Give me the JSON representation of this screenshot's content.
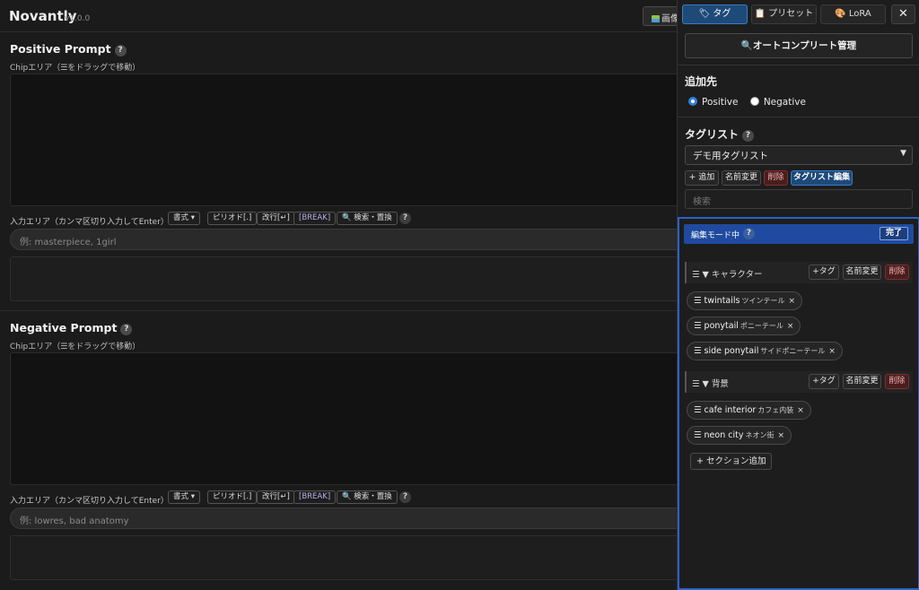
{
  "header": {
    "app_name": "Novantly",
    "version": "v1.0.0",
    "image_button": "画像"
  },
  "positive": {
    "title": "Positive Prompt",
    "help": "?",
    "chip_hint": "Chipエリア（☰をドラッグで移動）",
    "input_label": "入力エリア（カンマ区切り入力してEnter）",
    "toolbar": [
      "書式 ▾",
      "ピリオド[.]",
      "改行[↵]",
      "[BREAK]",
      "🔍 検索・置換"
    ],
    "placeholder": "例: masterpiece, 1girl"
  },
  "negative": {
    "title": "Negative Prompt",
    "help": "?",
    "chip_hint": "Chipエリア（☰をドラッグで移動）",
    "input_label": "入力エリア（カンマ区切り入力してEnter）",
    "toolbar": [
      "書式 ▾",
      "ピリオド[.]",
      "改行[↵]",
      "[BREAK]",
      "🔍 検索・置換"
    ],
    "placeholder": "例: lowres, bad anatomy"
  },
  "panel": {
    "tabs": [
      "🏷 タグ",
      "📋 プリセット",
      "🎨 LoRA"
    ],
    "close": "✕",
    "autocomplete_button": "🔍オートコンプリート管理",
    "target_heading": "追加先",
    "target_options": [
      "Positive",
      "Negative"
    ],
    "taglist_heading": "タグリスト",
    "taglist_select": "デモ用タグリスト",
    "taglist_buttons": {
      "add": "+ 追加",
      "rename": "名前変更",
      "delete": "削除",
      "edit": "タグリスト編集"
    },
    "search_placeholder": "検索",
    "editor": {
      "mode_label": "編集モード中",
      "done": "完了",
      "section_buttons": {
        "add_tag": "+タグ",
        "rename": "名前変更",
        "delete": "削除"
      },
      "sections": [
        {
          "name": "☰ ▼ キャラクター",
          "tags": [
            {
              "en": "☰ twintails",
              "jp": "ツインテール"
            },
            {
              "en": "☰ ponytail",
              "jp": "ポニーテール"
            },
            {
              "en": "☰ side ponytail",
              "jp": "サイドポニーテール"
            }
          ]
        },
        {
          "name": "☰ ▼ 背景",
          "tags": [
            {
              "en": "☰ cafe interior",
              "jp": "カフェ内装"
            },
            {
              "en": "☰ neon city",
              "jp": "ネオン街"
            }
          ]
        }
      ],
      "add_section": "+ セクション追加",
      "remove_icon": "×"
    }
  }
}
